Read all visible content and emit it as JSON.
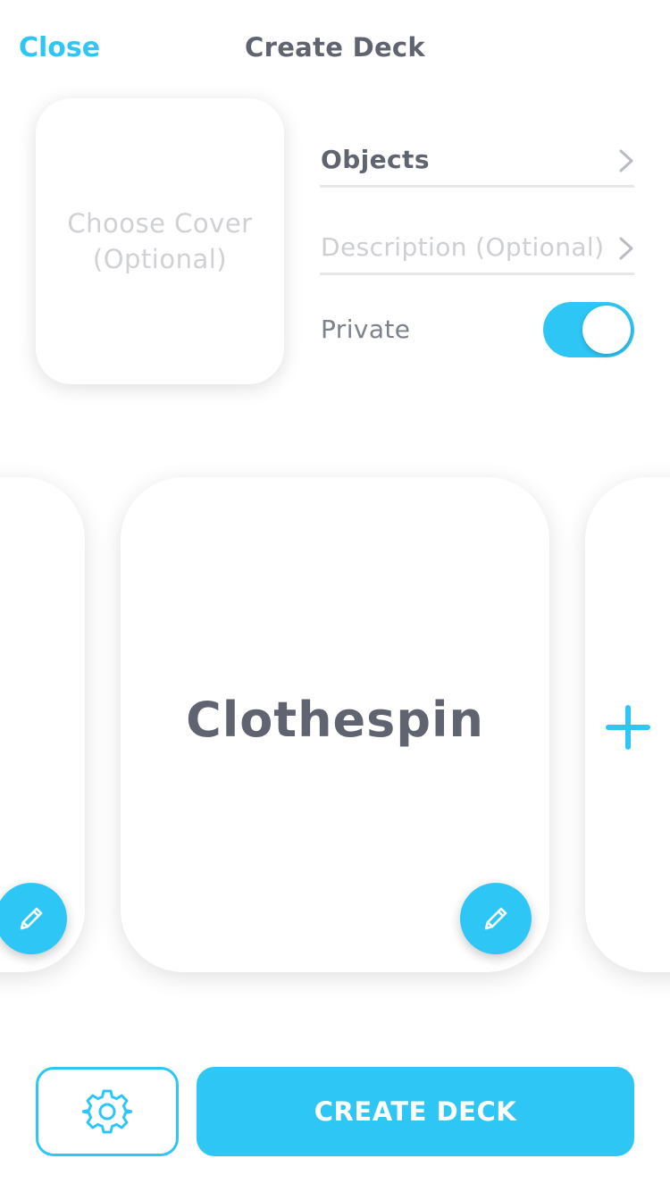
{
  "header": {
    "close_label": "Close",
    "title": "Create Deck"
  },
  "cover": {
    "label": "Choose Cover (Optional)"
  },
  "fields": {
    "objects_label": "Objects",
    "description_placeholder": "Description (Optional)",
    "private_label": "Private",
    "private_on": true
  },
  "cards": {
    "current_word": "Clothespin"
  },
  "footer": {
    "create_label": "CREATE DECK"
  },
  "icons": {
    "chevron": "chevron-right-icon",
    "edit": "pencil-icon",
    "add": "plus-icon",
    "settings": "gear-icon"
  },
  "colors": {
    "accent": "#2ec7f5",
    "text_dark": "#5f6470",
    "text_muted": "#cfd1d5"
  }
}
